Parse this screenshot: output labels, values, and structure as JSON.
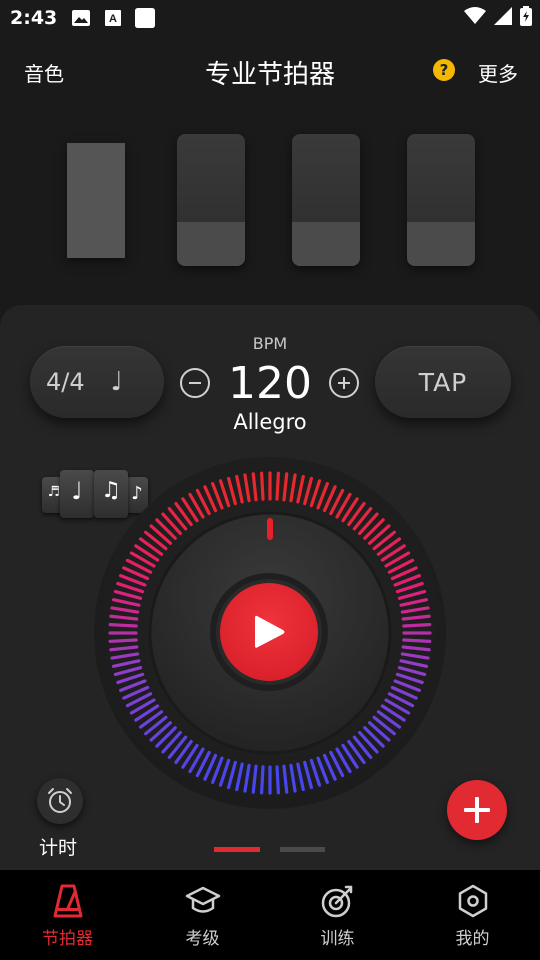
{
  "status_bar": {
    "time": "2:43",
    "left_icons": [
      "image-icon",
      "font-icon",
      "square-icon"
    ],
    "right_icons": [
      "wifi-icon",
      "signal-icon",
      "battery-icon"
    ]
  },
  "header": {
    "left_label": "音色",
    "title": "专业节拍器",
    "help_label": "?",
    "right_label": "更多"
  },
  "beats": [
    {
      "accent": true
    },
    {
      "accent": false
    },
    {
      "accent": false
    },
    {
      "accent": false
    }
  ],
  "controls": {
    "time_signature": "4/4",
    "note_glyph": "♩",
    "bpm_label": "BPM",
    "bpm_value": "120",
    "tempo_name": "Allegro",
    "tap_label": "TAP"
  },
  "timer_label": "计时",
  "pagination": {
    "count": 2,
    "active": 0
  },
  "nav": [
    {
      "label": "节拍器",
      "icon": "metronome-icon",
      "active": true
    },
    {
      "label": "考级",
      "icon": "graduation-cap-icon",
      "active": false
    },
    {
      "label": "训练",
      "icon": "target-icon",
      "active": false
    },
    {
      "label": "我的",
      "icon": "hexagon-icon",
      "active": false
    }
  ],
  "colors": {
    "accent": "#e22a33",
    "background": "#1a1a1a",
    "panel": "#242424",
    "help_badge": "#f5b800"
  }
}
